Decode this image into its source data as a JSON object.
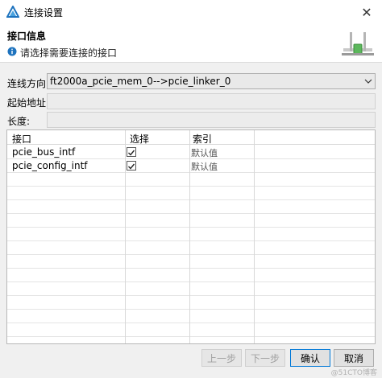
{
  "window": {
    "title": "连接设置",
    "close": "✕"
  },
  "header": {
    "title": "接口信息",
    "description": "请选择需要连接的接口"
  },
  "form": {
    "direction_label": "连线方向:",
    "direction_value": "ft2000a_pcie_mem_0-->pcie_linker_0",
    "start_address_label": "起始地址:",
    "start_address_value": "",
    "length_label": "长度:",
    "length_value": ""
  },
  "table": {
    "columns": [
      "接口",
      "选择",
      "索引"
    ],
    "rows": [
      {
        "name": "pcie_bus_intf",
        "checked": true,
        "index": "默认值"
      },
      {
        "name": "pcie_config_intf",
        "checked": true,
        "index": "默认值"
      }
    ]
  },
  "buttons": {
    "prev": "上一步",
    "next": "下一步",
    "ok": "确认",
    "cancel": "取消"
  },
  "watermark": "@51CTO博客",
  "colors": {
    "accent": "#0078d7",
    "border": "#adadad"
  }
}
